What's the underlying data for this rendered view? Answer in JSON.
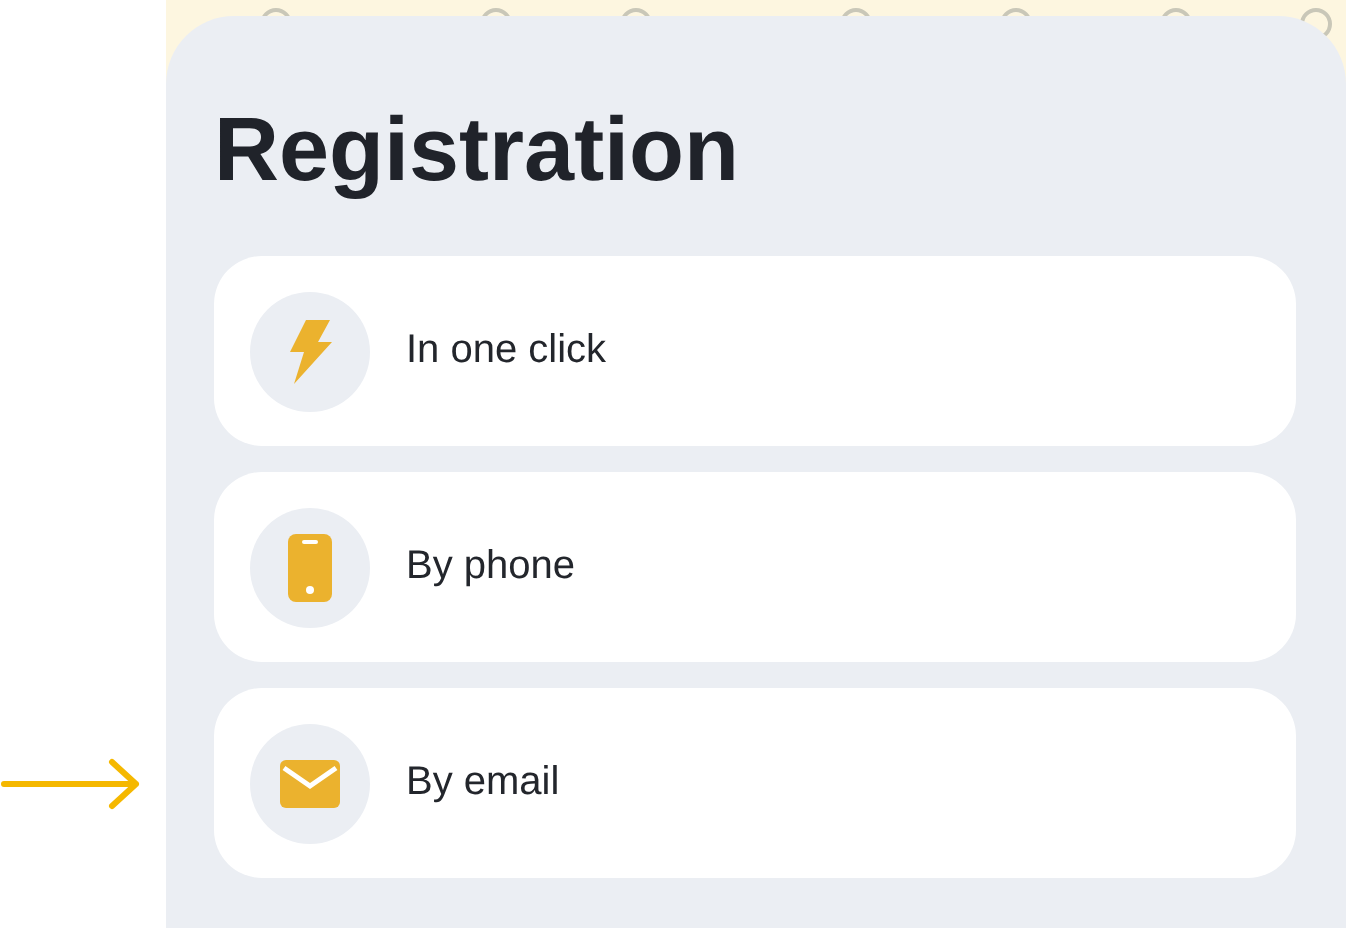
{
  "title": "Registration",
  "options": [
    {
      "kind": "click",
      "label": "In one click",
      "marked": false
    },
    {
      "kind": "phone",
      "label": "By phone",
      "marked": false
    },
    {
      "kind": "email",
      "label": "By email",
      "marked": true
    }
  ]
}
